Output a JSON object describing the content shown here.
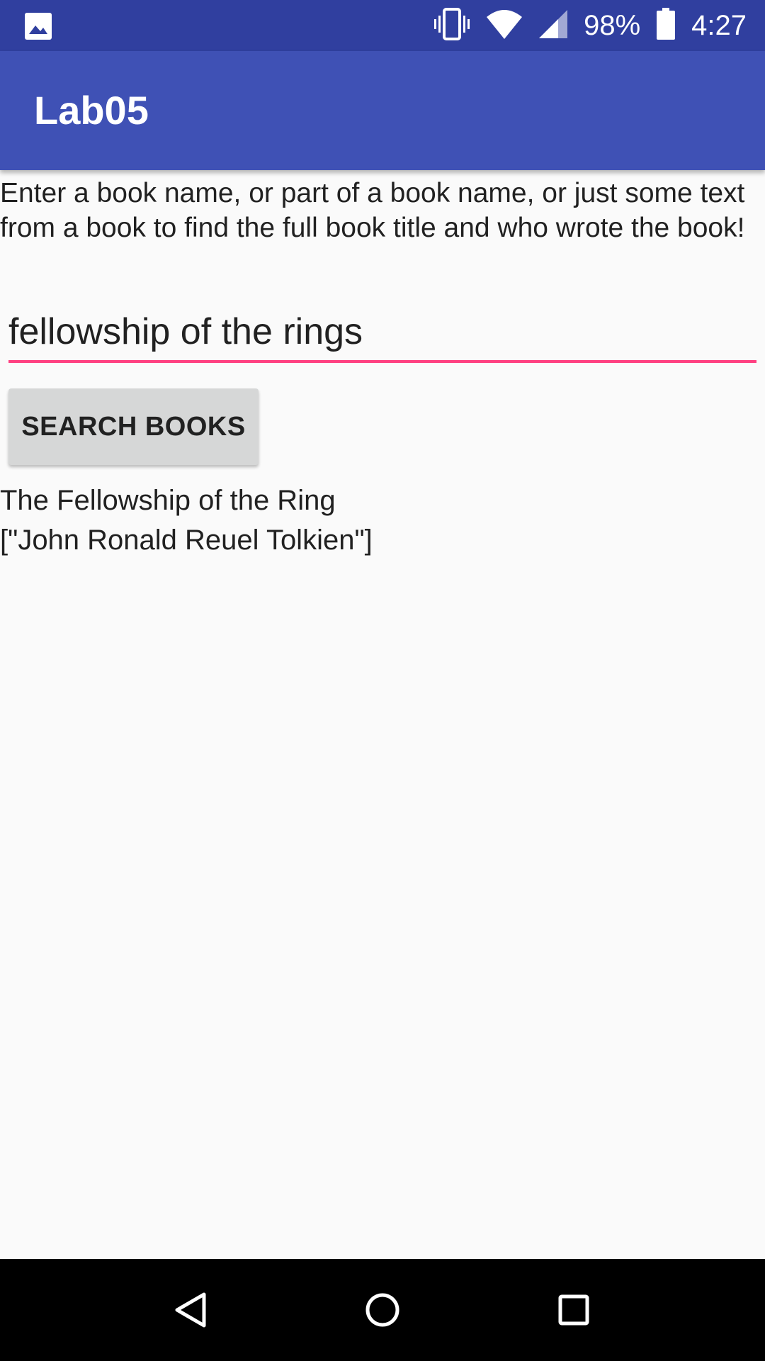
{
  "status_bar": {
    "battery_percent": "98%",
    "time": "4:27",
    "icons": [
      "image-icon",
      "vibrate-icon",
      "wifi-icon",
      "cell-signal-icon",
      "battery-icon"
    ]
  },
  "app_bar": {
    "title": "Lab05",
    "color": "#3f51b5"
  },
  "main": {
    "instructions": "Enter a book name, or part of a book name, or just some text from a book to find the full book title and who wrote the book!",
    "search_input_value": "fellowship of the rings",
    "search_button_label": "SEARCH BOOKS",
    "result_title": "The Fellowship of the Ring",
    "result_authors": "[\"John Ronald Reuel Tolkien\"]"
  },
  "colors": {
    "status_bar": "#303f9f",
    "accent": "#ff4081",
    "button": "#d6d7d7"
  },
  "nav_bar": {
    "buttons": [
      "back-icon",
      "home-icon",
      "recents-icon"
    ]
  }
}
